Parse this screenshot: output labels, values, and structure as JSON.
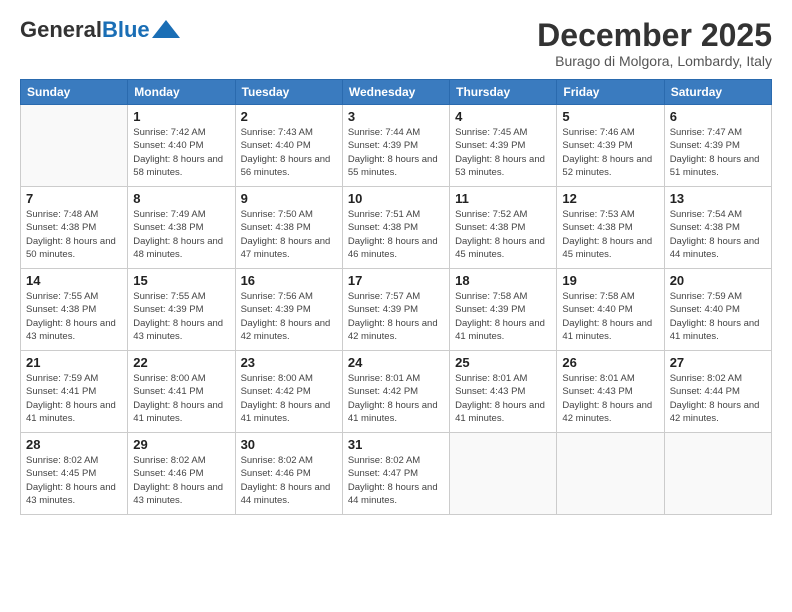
{
  "header": {
    "logo_general": "General",
    "logo_blue": "Blue",
    "month_title": "December 2025",
    "location": "Burago di Molgora, Lombardy, Italy"
  },
  "weekdays": [
    "Sunday",
    "Monday",
    "Tuesday",
    "Wednesday",
    "Thursday",
    "Friday",
    "Saturday"
  ],
  "weeks": [
    [
      {
        "day": "",
        "sunrise": "",
        "sunset": "",
        "daylight": ""
      },
      {
        "day": "1",
        "sunrise": "Sunrise: 7:42 AM",
        "sunset": "Sunset: 4:40 PM",
        "daylight": "Daylight: 8 hours and 58 minutes."
      },
      {
        "day": "2",
        "sunrise": "Sunrise: 7:43 AM",
        "sunset": "Sunset: 4:40 PM",
        "daylight": "Daylight: 8 hours and 56 minutes."
      },
      {
        "day": "3",
        "sunrise": "Sunrise: 7:44 AM",
        "sunset": "Sunset: 4:39 PM",
        "daylight": "Daylight: 8 hours and 55 minutes."
      },
      {
        "day": "4",
        "sunrise": "Sunrise: 7:45 AM",
        "sunset": "Sunset: 4:39 PM",
        "daylight": "Daylight: 8 hours and 53 minutes."
      },
      {
        "day": "5",
        "sunrise": "Sunrise: 7:46 AM",
        "sunset": "Sunset: 4:39 PM",
        "daylight": "Daylight: 8 hours and 52 minutes."
      },
      {
        "day": "6",
        "sunrise": "Sunrise: 7:47 AM",
        "sunset": "Sunset: 4:39 PM",
        "daylight": "Daylight: 8 hours and 51 minutes."
      }
    ],
    [
      {
        "day": "7",
        "sunrise": "Sunrise: 7:48 AM",
        "sunset": "Sunset: 4:38 PM",
        "daylight": "Daylight: 8 hours and 50 minutes."
      },
      {
        "day": "8",
        "sunrise": "Sunrise: 7:49 AM",
        "sunset": "Sunset: 4:38 PM",
        "daylight": "Daylight: 8 hours and 48 minutes."
      },
      {
        "day": "9",
        "sunrise": "Sunrise: 7:50 AM",
        "sunset": "Sunset: 4:38 PM",
        "daylight": "Daylight: 8 hours and 47 minutes."
      },
      {
        "day": "10",
        "sunrise": "Sunrise: 7:51 AM",
        "sunset": "Sunset: 4:38 PM",
        "daylight": "Daylight: 8 hours and 46 minutes."
      },
      {
        "day": "11",
        "sunrise": "Sunrise: 7:52 AM",
        "sunset": "Sunset: 4:38 PM",
        "daylight": "Daylight: 8 hours and 45 minutes."
      },
      {
        "day": "12",
        "sunrise": "Sunrise: 7:53 AM",
        "sunset": "Sunset: 4:38 PM",
        "daylight": "Daylight: 8 hours and 45 minutes."
      },
      {
        "day": "13",
        "sunrise": "Sunrise: 7:54 AM",
        "sunset": "Sunset: 4:38 PM",
        "daylight": "Daylight: 8 hours and 44 minutes."
      }
    ],
    [
      {
        "day": "14",
        "sunrise": "Sunrise: 7:55 AM",
        "sunset": "Sunset: 4:38 PM",
        "daylight": "Daylight: 8 hours and 43 minutes."
      },
      {
        "day": "15",
        "sunrise": "Sunrise: 7:55 AM",
        "sunset": "Sunset: 4:39 PM",
        "daylight": "Daylight: 8 hours and 43 minutes."
      },
      {
        "day": "16",
        "sunrise": "Sunrise: 7:56 AM",
        "sunset": "Sunset: 4:39 PM",
        "daylight": "Daylight: 8 hours and 42 minutes."
      },
      {
        "day": "17",
        "sunrise": "Sunrise: 7:57 AM",
        "sunset": "Sunset: 4:39 PM",
        "daylight": "Daylight: 8 hours and 42 minutes."
      },
      {
        "day": "18",
        "sunrise": "Sunrise: 7:58 AM",
        "sunset": "Sunset: 4:39 PM",
        "daylight": "Daylight: 8 hours and 41 minutes."
      },
      {
        "day": "19",
        "sunrise": "Sunrise: 7:58 AM",
        "sunset": "Sunset: 4:40 PM",
        "daylight": "Daylight: 8 hours and 41 minutes."
      },
      {
        "day": "20",
        "sunrise": "Sunrise: 7:59 AM",
        "sunset": "Sunset: 4:40 PM",
        "daylight": "Daylight: 8 hours and 41 minutes."
      }
    ],
    [
      {
        "day": "21",
        "sunrise": "Sunrise: 7:59 AM",
        "sunset": "Sunset: 4:41 PM",
        "daylight": "Daylight: 8 hours and 41 minutes."
      },
      {
        "day": "22",
        "sunrise": "Sunrise: 8:00 AM",
        "sunset": "Sunset: 4:41 PM",
        "daylight": "Daylight: 8 hours and 41 minutes."
      },
      {
        "day": "23",
        "sunrise": "Sunrise: 8:00 AM",
        "sunset": "Sunset: 4:42 PM",
        "daylight": "Daylight: 8 hours and 41 minutes."
      },
      {
        "day": "24",
        "sunrise": "Sunrise: 8:01 AM",
        "sunset": "Sunset: 4:42 PM",
        "daylight": "Daylight: 8 hours and 41 minutes."
      },
      {
        "day": "25",
        "sunrise": "Sunrise: 8:01 AM",
        "sunset": "Sunset: 4:43 PM",
        "daylight": "Daylight: 8 hours and 41 minutes."
      },
      {
        "day": "26",
        "sunrise": "Sunrise: 8:01 AM",
        "sunset": "Sunset: 4:43 PM",
        "daylight": "Daylight: 8 hours and 42 minutes."
      },
      {
        "day": "27",
        "sunrise": "Sunrise: 8:02 AM",
        "sunset": "Sunset: 4:44 PM",
        "daylight": "Daylight: 8 hours and 42 minutes."
      }
    ],
    [
      {
        "day": "28",
        "sunrise": "Sunrise: 8:02 AM",
        "sunset": "Sunset: 4:45 PM",
        "daylight": "Daylight: 8 hours and 43 minutes."
      },
      {
        "day": "29",
        "sunrise": "Sunrise: 8:02 AM",
        "sunset": "Sunset: 4:46 PM",
        "daylight": "Daylight: 8 hours and 43 minutes."
      },
      {
        "day": "30",
        "sunrise": "Sunrise: 8:02 AM",
        "sunset": "Sunset: 4:46 PM",
        "daylight": "Daylight: 8 hours and 44 minutes."
      },
      {
        "day": "31",
        "sunrise": "Sunrise: 8:02 AM",
        "sunset": "Sunset: 4:47 PM",
        "daylight": "Daylight: 8 hours and 44 minutes."
      },
      {
        "day": "",
        "sunrise": "",
        "sunset": "",
        "daylight": ""
      },
      {
        "day": "",
        "sunrise": "",
        "sunset": "",
        "daylight": ""
      },
      {
        "day": "",
        "sunrise": "",
        "sunset": "",
        "daylight": ""
      }
    ]
  ]
}
